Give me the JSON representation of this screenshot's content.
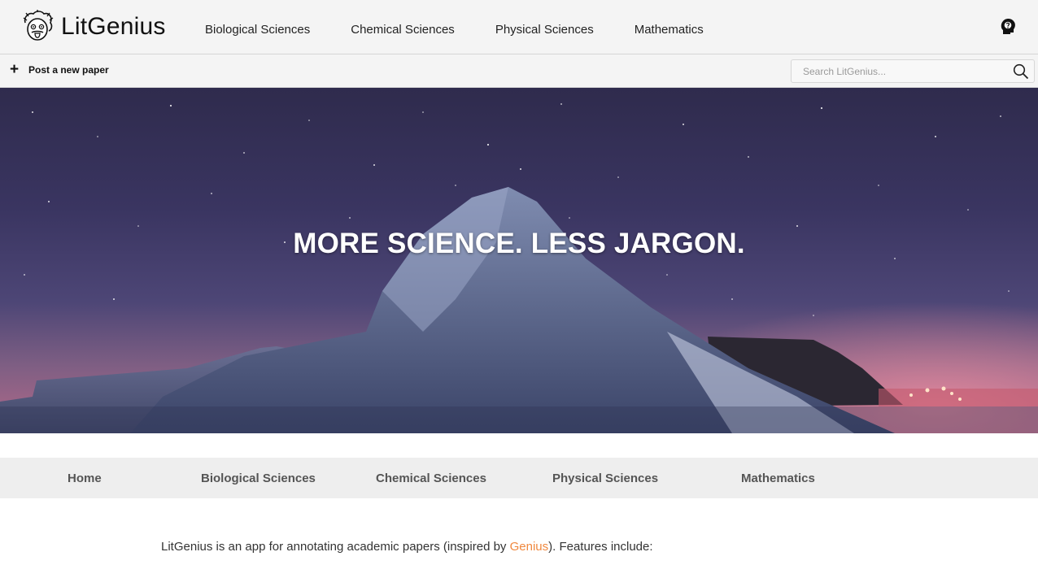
{
  "header": {
    "logo_text": "LitGenius",
    "nav": [
      "Biological Sciences",
      "Chemical Sciences",
      "Physical Sciences",
      "Mathematics"
    ]
  },
  "toolbar": {
    "post_label": "Post a new paper",
    "search_placeholder": "Search LitGenius..."
  },
  "hero": {
    "headline": "MORE SCIENCE. LESS JARGON."
  },
  "subnav": {
    "items": [
      "Home",
      "Biological Sciences",
      "Chemical Sciences",
      "Physical Sciences",
      "Mathematics"
    ]
  },
  "intro": {
    "before": "LitGenius is an app for annotating academic papers (inspired by ",
    "link": "Genius",
    "after": "). Features include:"
  },
  "colors": {
    "accent_link": "#f0883e",
    "header_bg": "#f4f4f4",
    "subnav_bg": "#eeeeee"
  },
  "icons": [
    "einstein-logo-icon",
    "user-head-icon",
    "plus-icon",
    "search-icon"
  ]
}
